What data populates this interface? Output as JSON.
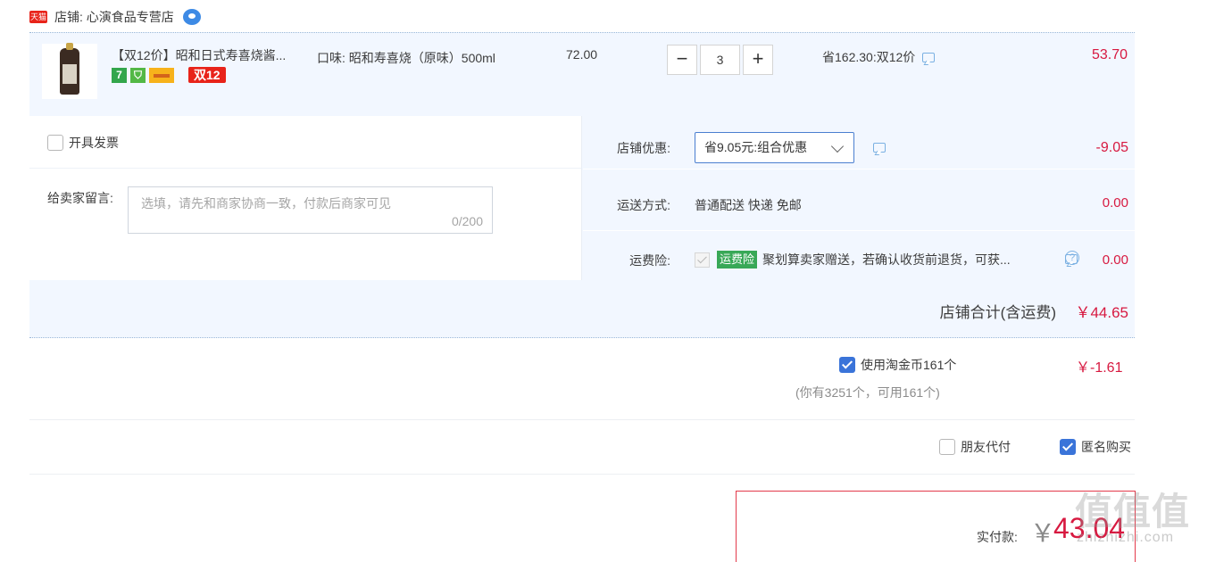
{
  "shop": {
    "badge": "天猫",
    "name": "店铺: 心演食品专营店"
  },
  "item": {
    "title": "【双12价】昭和日式寿喜烧酱...",
    "badge_7": "7",
    "badge_double12": "双12",
    "sku": "口味: 昭和寿喜烧（原味）500ml",
    "price": "72.00",
    "qty_minus": "−",
    "quantity": "3",
    "qty_plus": "+",
    "saving": "省162.30:双12价",
    "subtotal": "53.70"
  },
  "options": {
    "invoice_label": "开具发票",
    "memo_label": "给卖家留言:",
    "memo_placeholder": "选填，请先和商家协商一致，付款后商家可见",
    "memo_count": "0/200",
    "coupon_label": "店铺优惠:",
    "coupon_value": "省9.05元:组合优惠",
    "coupon_amount": "-9.05",
    "shipping_label": "运送方式:",
    "shipping_value": "普通配送 快递 免邮",
    "shipping_amount": "0.00",
    "insurance_label": "运费险:",
    "insurance_badge": "运费险",
    "insurance_text": "聚划算卖家赠送，若确认收货前退货，可获...",
    "insurance_amount": "0.00"
  },
  "totals": {
    "shop_total_label": "店铺合计(含运费)",
    "shop_total_value": "￥44.65",
    "coins_label": "使用淘金币161个",
    "coins_note": "(你有3251个，可用161个)",
    "coins_value": "￥-1.61",
    "friend_pay_label": "朋友代付",
    "anonymous_label": "匿名购买",
    "pay_label": "实付款:",
    "pay_currency": "￥",
    "pay_value": "43.04"
  },
  "watermark": {
    "main": "值值值",
    "sub": "zhizhizhi.com"
  },
  "colors": {
    "accent_blue": "#3a74d9",
    "price_red": "#d71940",
    "panel_bg": "#f2f7ff"
  }
}
